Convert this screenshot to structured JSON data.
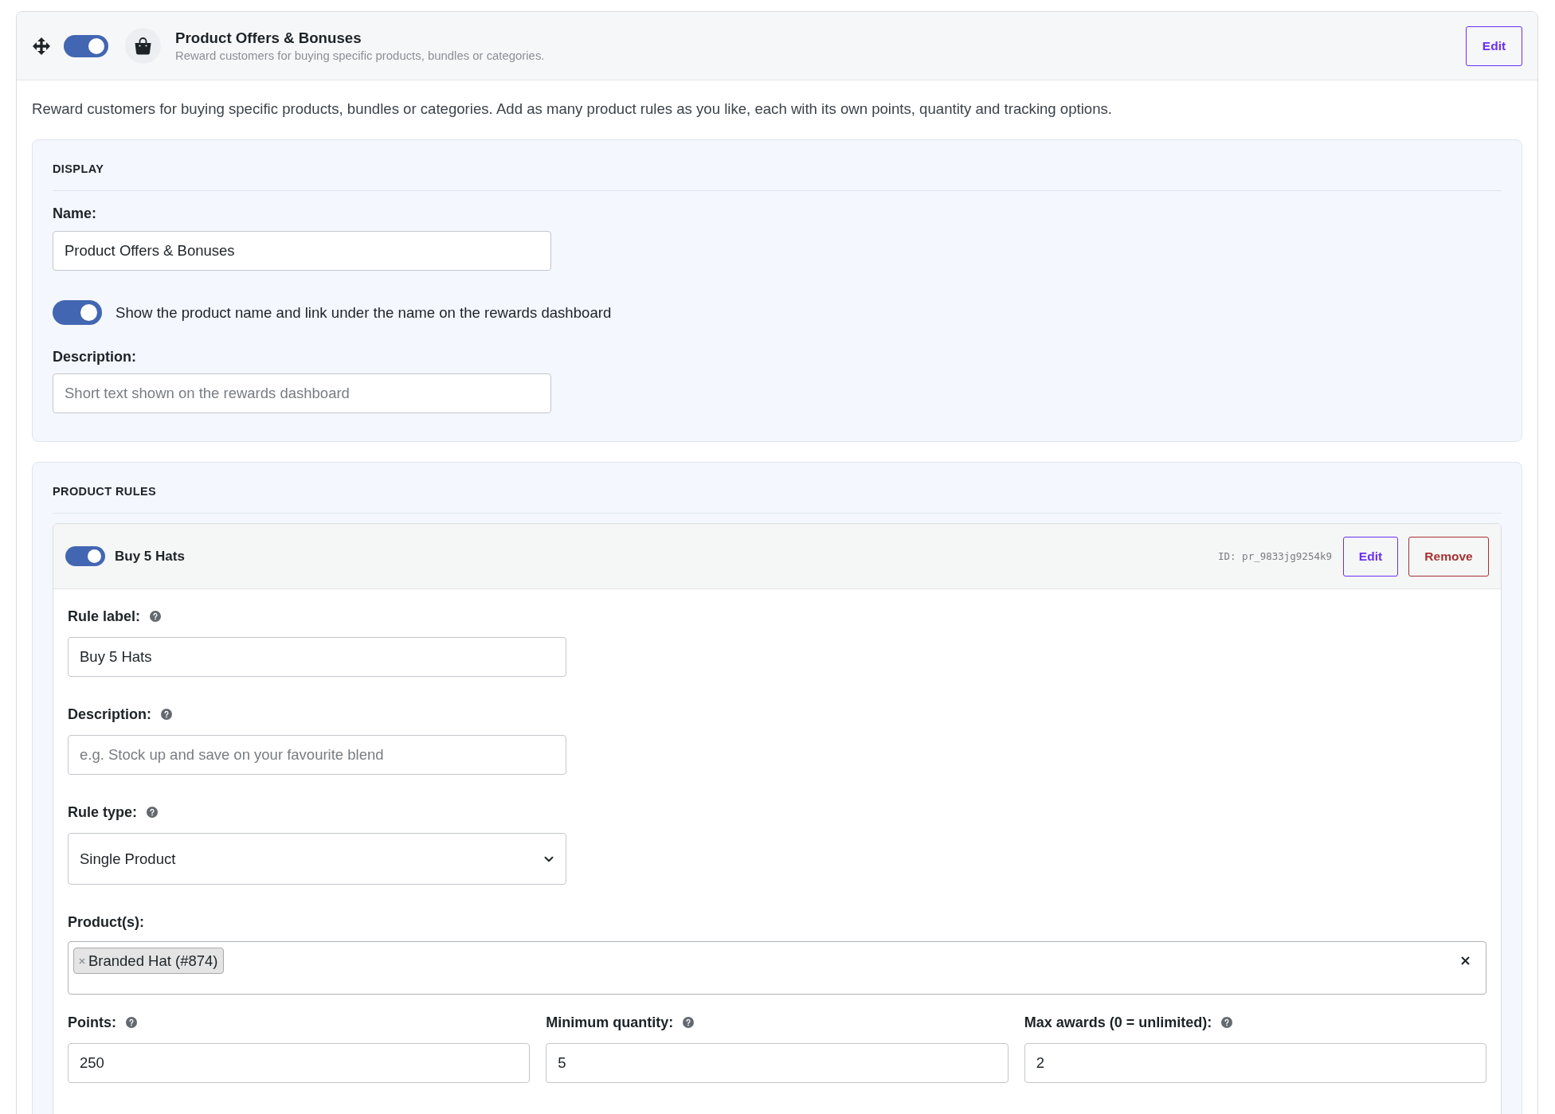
{
  "module": {
    "enabled": true,
    "title": "Product Offers & Bonuses",
    "subtitle": "Reward customers for buying specific products, bundles or categories.",
    "edit_label": "Edit"
  },
  "intro": "Reward customers for buying specific products, bundles or categories. Add as many product rules as you like, each with its own points, quantity and tracking options.",
  "display": {
    "heading": "DISPLAY",
    "name": {
      "label": "Name:",
      "value": "Product Offers & Bonuses"
    },
    "show_product": {
      "on": true,
      "label": "Show the product name and link under the name on the rewards dashboard"
    },
    "description": {
      "label": "Description:",
      "placeholder": "Short text shown on the rewards dashboard"
    }
  },
  "product_rules": {
    "heading": "PRODUCT RULES",
    "rules": [
      {
        "enabled": true,
        "title": "Buy 5 Hats",
        "id": "ID: pr_9833jg9254k9",
        "buttons": [
          {
            "kind": "edit",
            "label": "Edit"
          },
          {
            "kind": "remove",
            "label": "Remove"
          }
        ],
        "fields": [
          {
            "kind": "text",
            "label": "Rule label:",
            "help": true,
            "value": "Buy 5 Hats"
          },
          {
            "kind": "text",
            "label": "Description:",
            "help": true,
            "placeholder": "e.g. Stock up and save on your favourite blend"
          },
          {
            "kind": "select",
            "label": "Rule type:",
            "help": true,
            "value": "Single Product"
          },
          {
            "kind": "tags",
            "label": "Product(s):",
            "help": false,
            "tags": [
              "Branded Hat (#874)"
            ]
          }
        ],
        "limits": [
          {
            "label": "Points:",
            "help": true,
            "value": "250"
          },
          {
            "label": "Minimum quantity:",
            "help": true,
            "value": "5"
          },
          {
            "label": "Max awards (0 = unlimited):",
            "help": true,
            "value": "2"
          }
        ]
      }
    ]
  }
}
